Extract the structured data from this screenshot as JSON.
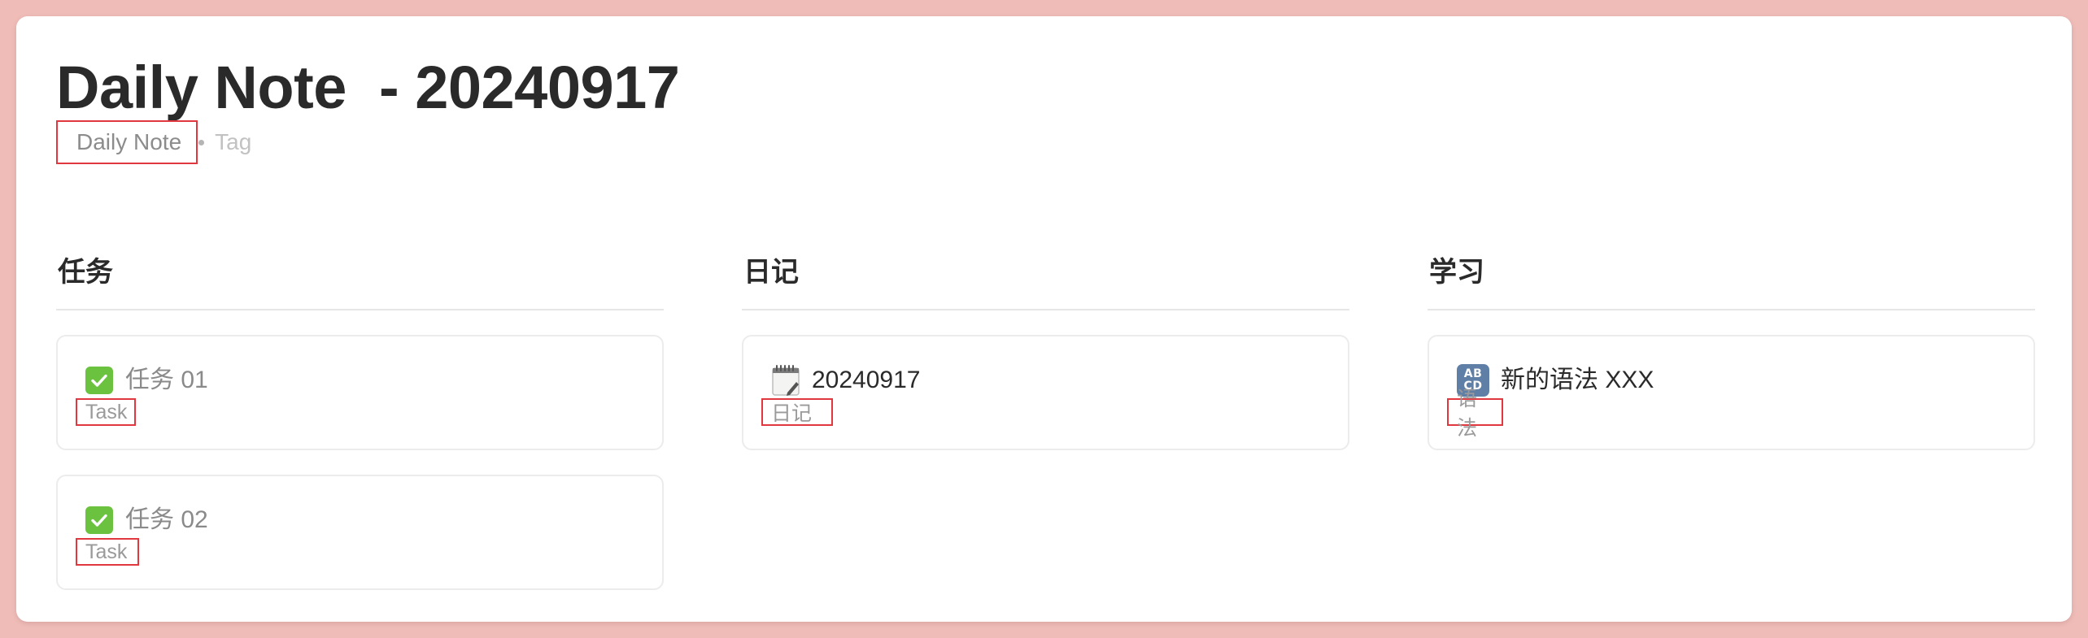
{
  "page": {
    "title": "Daily Note  - 20240917",
    "properties": {
      "category": "Daily Note",
      "tag": "Tag"
    }
  },
  "columns": [
    {
      "header": "任务",
      "cards": [
        {
          "icon": "checkmark-icon",
          "title": "任务 01",
          "tag": "Task"
        },
        {
          "icon": "checkmark-icon",
          "title": "任务 02",
          "tag": "Task"
        }
      ]
    },
    {
      "header": "日记",
      "cards": [
        {
          "icon": "notepad-icon",
          "title": "20240917",
          "tag": "日记"
        }
      ]
    },
    {
      "header": "学习",
      "cards": [
        {
          "icon": "abcd-icon",
          "icon_text": [
            "AB",
            "CD"
          ],
          "title": "新的语法 XXX",
          "tag": "语法"
        }
      ]
    }
  ],
  "colors": {
    "background": "#efbcb8",
    "highlight_border": "#e0383e",
    "check_green": "#6ac23e"
  }
}
